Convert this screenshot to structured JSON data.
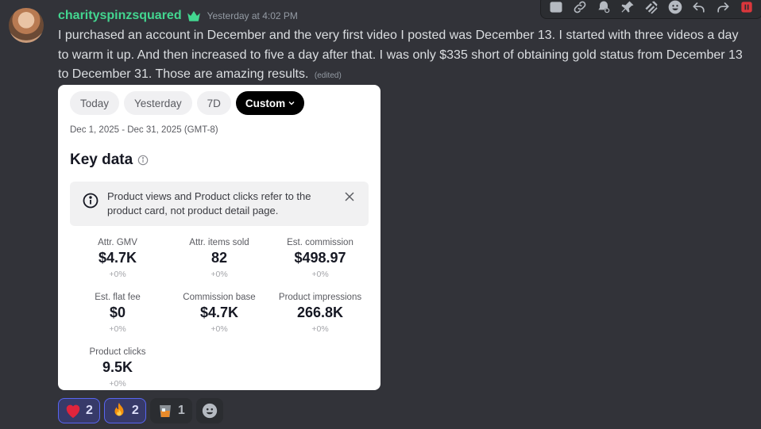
{
  "toolbar": {
    "buttons": [
      {
        "name": "copy-id-icon"
      },
      {
        "name": "copy-link-icon"
      },
      {
        "name": "mark-unread-icon"
      },
      {
        "name": "pin-icon"
      },
      {
        "name": "apps-icon"
      },
      {
        "name": "add-reaction-icon"
      },
      {
        "name": "reply-icon"
      },
      {
        "name": "forward-icon"
      },
      {
        "name": "delete-icon"
      }
    ]
  },
  "message": {
    "username": "charityspinzsquared",
    "timestamp": "Yesterday at 4:02 PM",
    "text": "I purchased an account in December and the very first video I posted was December 13. I started with three videos a day to warm it up. And then increased to five a day after that. I was only $335 short of obtaining gold status from December 13 to December 31. Those are amazing results.",
    "edited": "(edited)"
  },
  "card": {
    "chips": [
      "Today",
      "Yesterday",
      "7D",
      "Custom"
    ],
    "date_range": "Dec 1, 2025 - Dec 31, 2025 (GMT-8)",
    "section_title": "Key data",
    "notice": "Product views and Product clicks refer to the product card, not product detail page.",
    "metrics": [
      {
        "label": "Attr. GMV",
        "value": "$4.7K",
        "change": "+0%"
      },
      {
        "label": "Attr. items sold",
        "value": "82",
        "change": "+0%"
      },
      {
        "label": "Est. commission",
        "value": "$498.97",
        "change": "+0%"
      },
      {
        "label": "Est. flat fee",
        "value": "$0",
        "change": "+0%"
      },
      {
        "label": "Commission base",
        "value": "$4.7K",
        "change": "+0%"
      },
      {
        "label": "Product impressions",
        "value": "266.8K",
        "change": "+0%"
      },
      {
        "label": "Product clicks",
        "value": "9.5K",
        "change": "+0%"
      }
    ]
  },
  "reactions": [
    {
      "emoji": "❤️",
      "count": "2",
      "me": true
    },
    {
      "emoji": "🔥",
      "count": "2",
      "me": true
    },
    {
      "emoji": "🥃",
      "count": "1",
      "me": false
    }
  ],
  "colors": {
    "background": "#323339",
    "username": "#43d690",
    "reaction_active_border": "#5865f2",
    "delete_accent": "#da373c"
  }
}
